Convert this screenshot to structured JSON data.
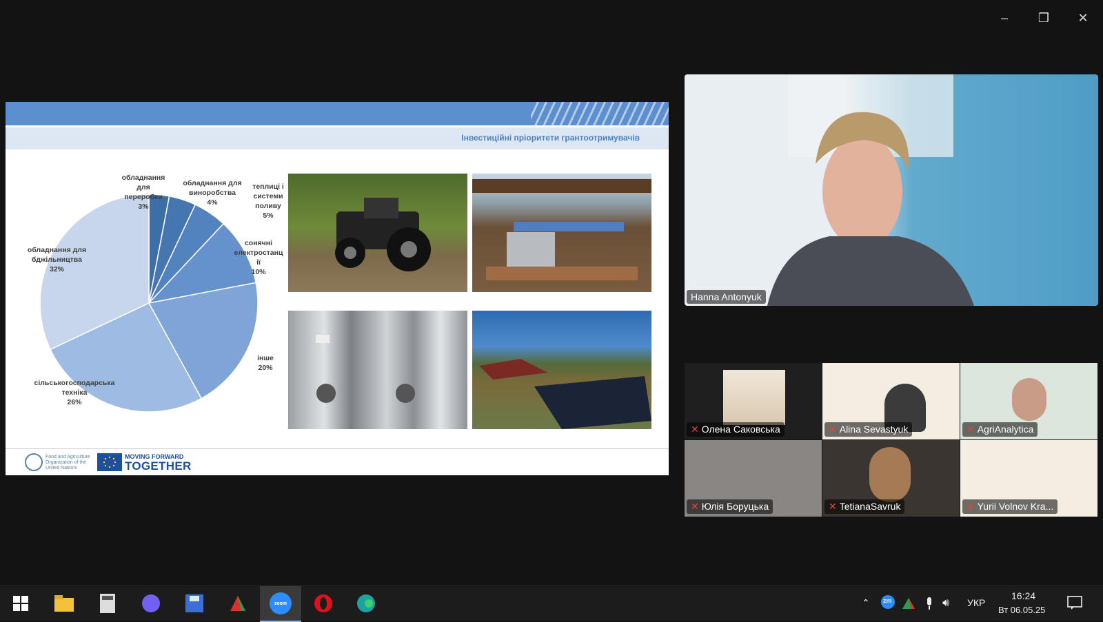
{
  "window_controls": [
    "minimize",
    "restore",
    "close"
  ],
  "slide": {
    "heading": "Інвестиційні пріоритети грантоотримувачів",
    "pie_labels": [
      {
        "l1": "обладнання",
        "l2": "для",
        "l3": "переробки",
        "pct": "3%"
      },
      {
        "l1": "обладнання для",
        "l2": "виноробства",
        "l3": "",
        "pct": "4%"
      },
      {
        "l1": "теплиці і",
        "l2": "системи",
        "l3": "поливу",
        "pct": "5%"
      },
      {
        "l1": "сонячні",
        "l2": "електростанц",
        "l3": "ії",
        "pct": "10%"
      },
      {
        "l1": "інше",
        "l2": "",
        "l3": "",
        "pct": "20%"
      },
      {
        "l1": "сільськогосподарська",
        "l2": "техніка",
        "l3": "",
        "pct": "26%"
      },
      {
        "l1": "обладнання для",
        "l2": "бджільництва",
        "l3": "",
        "pct": "32%"
      }
    ],
    "footer": {
      "fao_text": "Food and Agriculture Organization of the United Nations",
      "mft_line1": "MOVING FORWARD",
      "mft_line2": "TOGETHER"
    }
  },
  "chart_data": {
    "type": "pie",
    "categories": [
      "обладнання для переробки",
      "обладнання для виноробства",
      "теплиці і системи поливу",
      "сонячні електростанції",
      "інше",
      "сільськогосподарська техніка",
      "обладнання для бджільництва"
    ],
    "values": [
      3,
      4,
      5,
      10,
      20,
      26,
      32
    ],
    "colors": [
      "#3c6ea8",
      "#4676b0",
      "#5383bf",
      "#6592cc",
      "#7ea4d8",
      "#9dbbe3",
      "#c7d6ec"
    ]
  },
  "main_video": {
    "name": "Hanna Antonyuk"
  },
  "participants": [
    {
      "name": "Олена Саковська"
    },
    {
      "name": "Alina Sevastyuk"
    },
    {
      "name": "AgriAnalytica"
    },
    {
      "name": "Юлія Боруцька"
    },
    {
      "name": "TetianaSavruk"
    },
    {
      "name": "Yurii Volnov Kra..."
    }
  ],
  "taskbar": {
    "zoom_label": "zoom",
    "lang": "УКР",
    "time": "16:24",
    "date": "Вт 06.05.25",
    "zm_label": "zm"
  }
}
